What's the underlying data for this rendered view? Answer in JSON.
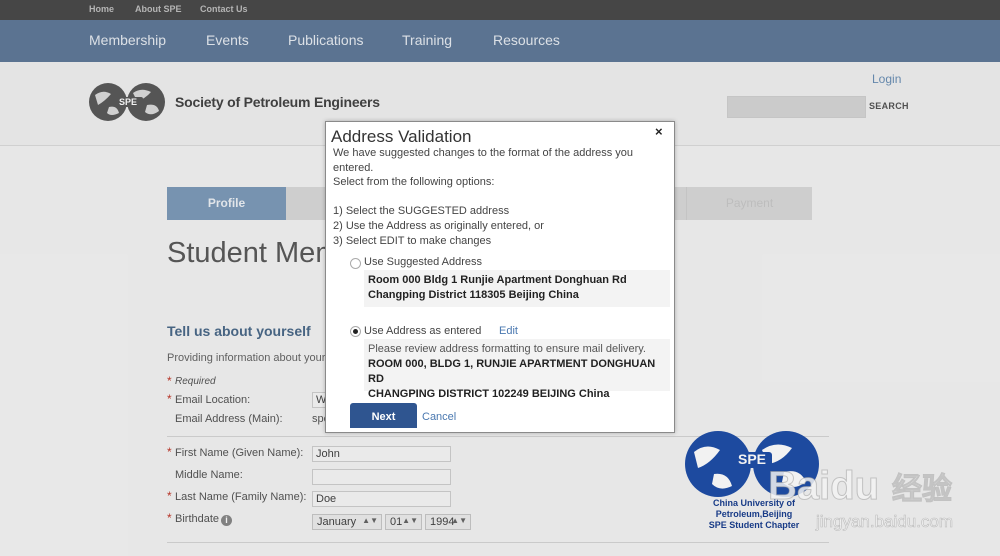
{
  "topbar": {
    "home": "Home",
    "about": "About SPE",
    "contact": "Contact Us"
  },
  "nav": {
    "membership": "Membership",
    "events": "Events",
    "publications": "Publications",
    "training": "Training",
    "resources": "Resources"
  },
  "header": {
    "brand": "Society of Petroleum Engineers",
    "logo_text": "SPE",
    "login": "Login",
    "search_button": "SEARCH",
    "search_placeholder": ""
  },
  "steps": {
    "profile": "Profile",
    "payment": "Payment"
  },
  "page": {
    "title": "Student Mem",
    "section_title": "Tell us about yourself",
    "section_desc": "Providing information about your",
    "required_note": "Required",
    "email_location_label": "Email Location:",
    "email_location_value": "W",
    "email_address_label": "Email Address (Main):",
    "email_address_value": "spe",
    "first_name_label": "First Name (Given Name):",
    "first_name_value": "John",
    "middle_name_label": "Middle Name:",
    "middle_name_value": "",
    "last_name_label": "Last Name (Family Name):",
    "last_name_value": "Doe",
    "birthdate_label": "Birthdate",
    "birth_month": "January",
    "birth_day": "01",
    "birth_year": "1994"
  },
  "watermark": {
    "logo_text": "SPE",
    "line1": "China University of",
    "line2": "Petroleum,Beijing",
    "line3": "SPE Student Chapter",
    "baidu_brand": "Baidu",
    "baidu_cn": "经验",
    "baidu_url": "jingyan.baidu.com"
  },
  "modal": {
    "title": "Address Validation",
    "close": "×",
    "intro_1": "We have suggested changes to the format of the address you entered.",
    "intro_2": "Select from the following options:",
    "option_1": "1) Select the SUGGESTED address",
    "option_2": "2) Use the Address as originally entered, or",
    "option_3": "3) Select EDIT to make changes",
    "suggested_label": "Use Suggested Address",
    "suggested_line1": "Room 000 Bldg 1 Runjie Apartment Donghuan Rd",
    "suggested_line2": "Changping District 118305 Beijing China",
    "entered_label": "Use Address as entered",
    "edit_link": "Edit",
    "entered_note": "Please review address formatting to ensure mail delivery.",
    "entered_line1": "ROOM 000, BLDG 1, RUNJIE APARTMENT DONGHUAN RD",
    "entered_line2": "CHANGPING DISTRICT 102249 BEIJING China",
    "next_button": "Next",
    "cancel_link": "Cancel"
  }
}
